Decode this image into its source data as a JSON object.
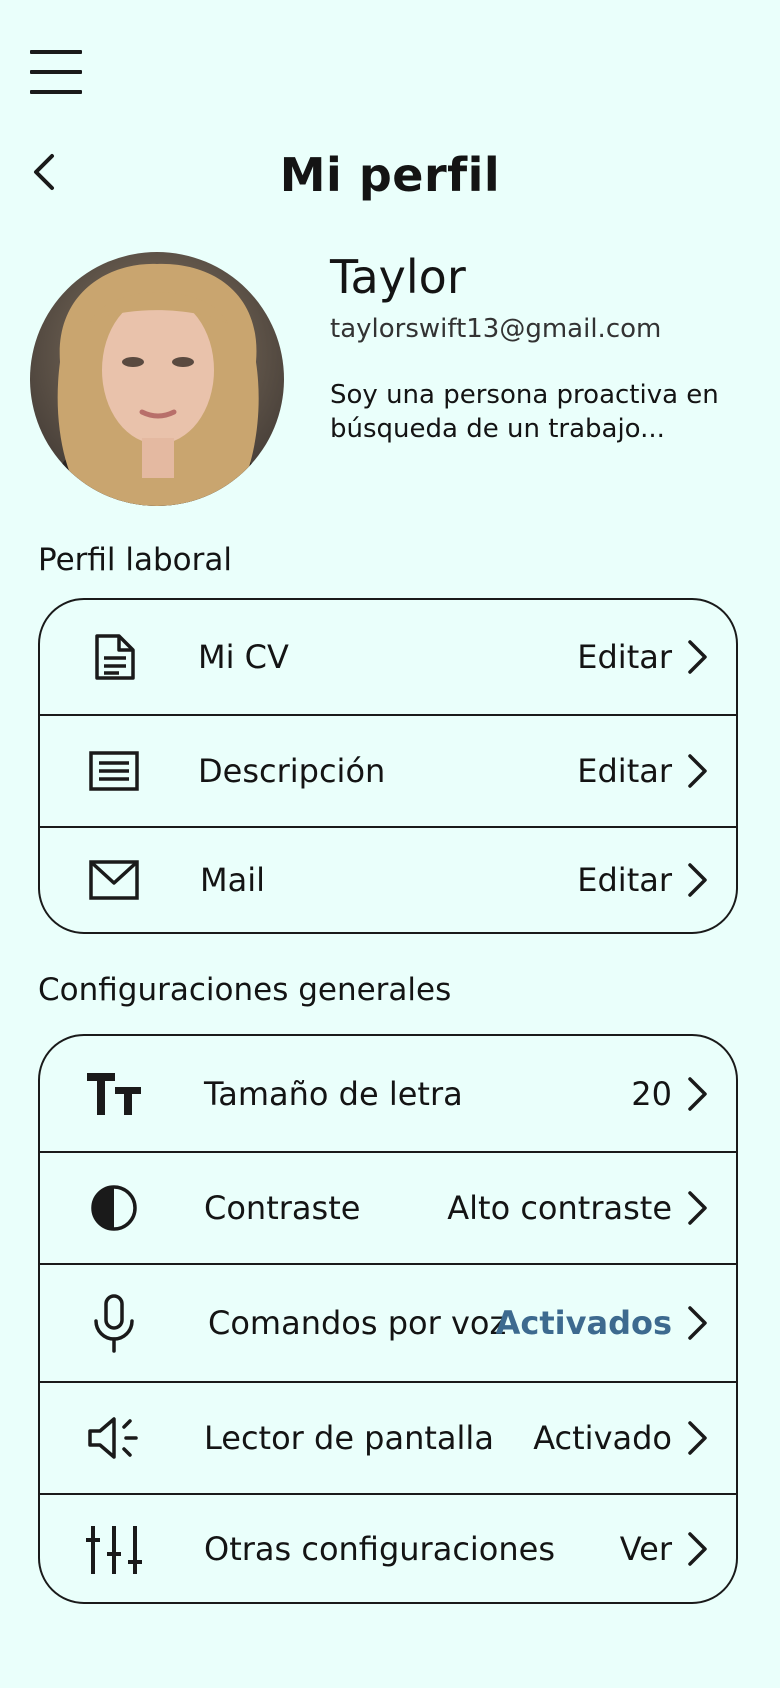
{
  "header": {
    "title": "Mi perfil",
    "menu_icon": "hamburger-menu-icon",
    "back_icon": "chevron-left-icon"
  },
  "profile": {
    "name": "Taylor",
    "email": "taylorswift13@gmail.com",
    "bio": "Soy una persona proactiva en búsqueda de un trabajo..."
  },
  "laboral": {
    "title": "Perfil laboral",
    "items": [
      {
        "label": "Mi CV",
        "value": "Editar",
        "icon": "document-icon"
      },
      {
        "label": "Descripción",
        "value": "Editar",
        "icon": "text-lines-icon"
      },
      {
        "label": "Mail",
        "value": "Editar",
        "icon": "envelope-icon"
      }
    ]
  },
  "config": {
    "title": "Configuraciones generales",
    "items": [
      {
        "label": "Tamaño de letra",
        "value": "20",
        "icon": "text-size-icon"
      },
      {
        "label": "Contraste",
        "value": "Alto contraste",
        "icon": "contrast-icon"
      },
      {
        "label": "Comandos por voz",
        "value": "Activados",
        "icon": "microphone-icon"
      },
      {
        "label": "Lector de pantalla",
        "value": "Activado",
        "icon": "speaker-icon"
      },
      {
        "label": "Otras configuraciones",
        "value": "Ver",
        "icon": "sliders-icon"
      }
    ]
  },
  "colors": {
    "background": "#eafffb",
    "accent": "#3d6a8f",
    "text": "#141414"
  }
}
